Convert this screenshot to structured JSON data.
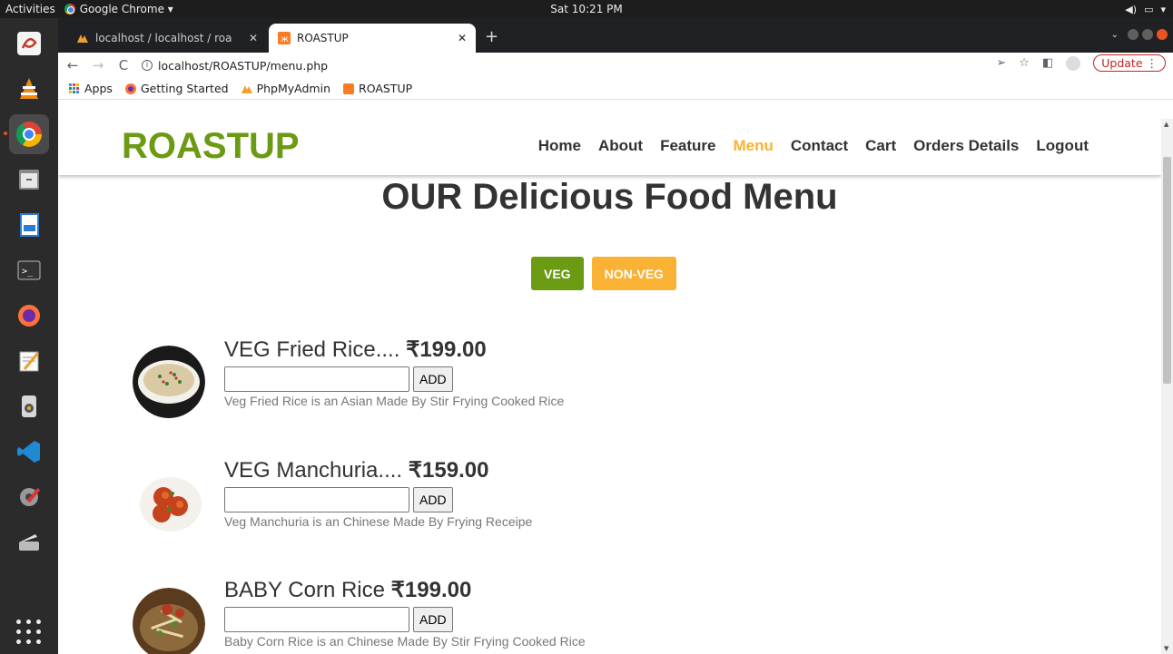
{
  "os": {
    "activities": "Activities",
    "app_name": "Google Chrome ▾",
    "clock": "Sat 10:21 PM"
  },
  "browser": {
    "tabs": [
      {
        "label": "localhost / localhost / roa"
      },
      {
        "label": "ROASTUP"
      }
    ],
    "url": "localhost/ROASTUP/menu.php",
    "update_label": "Update",
    "bookmarks": [
      "Apps",
      "Getting Started",
      "PhpMyAdmin",
      "ROASTUP"
    ]
  },
  "site": {
    "logo": "ROASTUP",
    "nav": [
      "Home",
      "About",
      "Feature",
      "Menu",
      "Contact",
      "Cart",
      "Orders Details",
      "Logout"
    ],
    "active_nav": "Menu",
    "page_title": "OUR Delicious Food Menu",
    "filters": [
      "VEG",
      "NON-VEG"
    ],
    "add_label": "ADD",
    "items": [
      {
        "name": "VEG Fried Rice....",
        "price": "₹199.00",
        "description": "Veg Fried Rice is an Asian Made By Stir Frying Cooked Rice"
      },
      {
        "name": "VEG Manchuria....",
        "price": "₹159.00",
        "description": "Veg Manchuria is an Chinese Made By Frying Receipe"
      },
      {
        "name": "BABY Corn Rice",
        "price": "₹199.00",
        "description": "Baby Corn Rice is an Chinese Made By Stir Frying Cooked Rice"
      }
    ]
  },
  "colors": {
    "brand_green": "#6b9a13",
    "brand_orange": "#f9b234"
  }
}
